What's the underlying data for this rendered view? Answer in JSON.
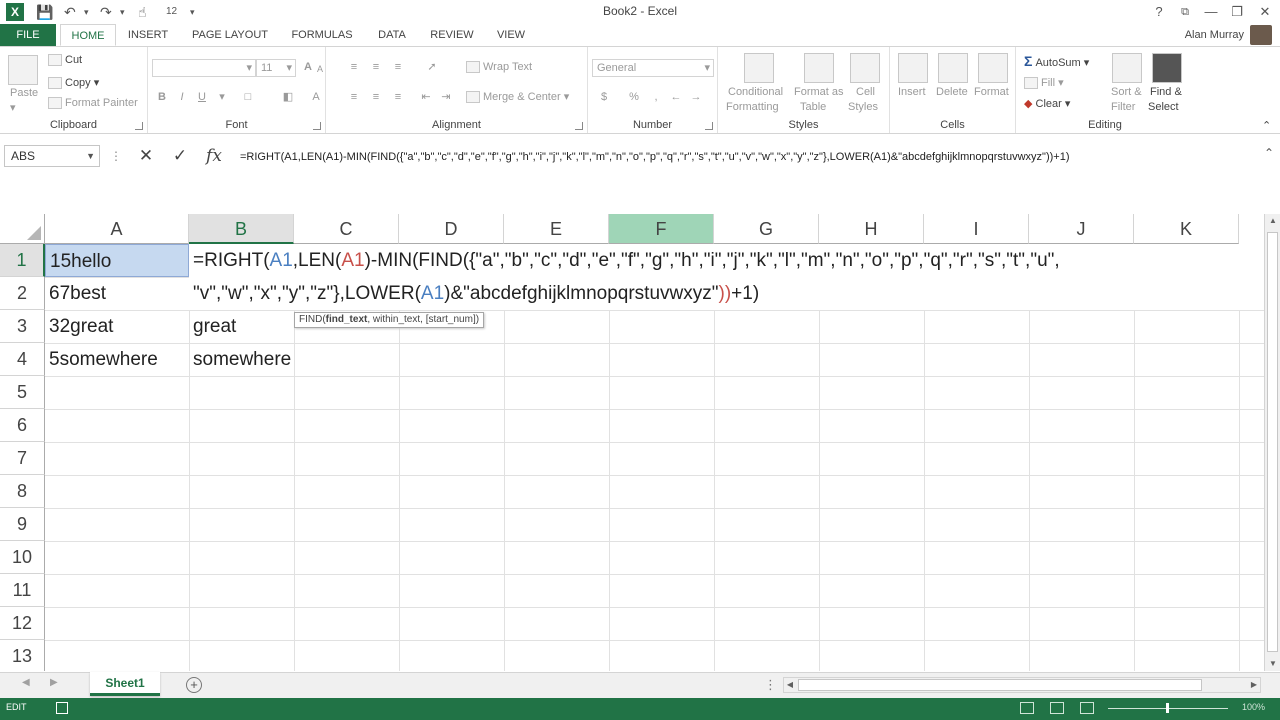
{
  "window": {
    "title": "Book2 - Excel",
    "help": "?",
    "restore": "⧉",
    "minimize": "—",
    "maximize": "❐",
    "close": "✕",
    "qat": [
      "save",
      "undo",
      "redo",
      "touch-mode"
    ]
  },
  "tabs": {
    "file": "FILE",
    "home": "HOME",
    "insert": "INSERT",
    "page_layout": "PAGE LAYOUT",
    "formulas": "FORMULAS",
    "data": "DATA",
    "review": "REVIEW",
    "view": "VIEW",
    "user": "Alan Murray"
  },
  "ribbon": {
    "clipboard": {
      "label": "Clipboard",
      "paste": "Paste",
      "cut": "Cut",
      "copy": "Copy",
      "format_painter": "Format Painter"
    },
    "font": {
      "label": "Font",
      "size": "11",
      "bold": "B",
      "italic": "I",
      "underline": "U",
      "grow": "A",
      "shrink": "A"
    },
    "alignment": {
      "label": "Alignment",
      "wrap_text": "Wrap Text",
      "merge_center": "Merge & Center"
    },
    "number": {
      "label": "Number",
      "format": "General",
      "percent": "%",
      "comma": ","
    },
    "styles": {
      "label": "Styles",
      "conditional": "Conditional",
      "formatting": "Formatting",
      "format_as": "Format as",
      "table": "Table",
      "cell": "Cell",
      "cell_styles": "Styles"
    },
    "cells": {
      "label": "Cells",
      "insert": "Insert",
      "delete": "Delete",
      "format": "Format"
    },
    "editing": {
      "label": "Editing",
      "autosum": "AutoSum",
      "fill": "Fill",
      "clear": "Clear",
      "sort": "Sort &",
      "filter": "Filter",
      "find": "Find &",
      "select": "Select"
    }
  },
  "formula_bar": {
    "name_box": "ABS",
    "cancel": "✕",
    "enter": "✓",
    "fx": "fx",
    "formula": "=RIGHT(A1,LEN(A1)-MIN(FIND({\"a\",\"b\",\"c\",\"d\",\"e\",\"f\",\"g\",\"h\",\"i\",\"j\",\"k\",\"l\",\"m\",\"n\",\"o\",\"p\",\"q\",\"r\",\"s\",\"t\",\"u\",\"v\",\"w\",\"x\",\"y\",\"z\"},LOWER(A1)&\"abcdefghijklmnopqrstuvwxyz\"))+1)"
  },
  "grid": {
    "columns": [
      "A",
      "B",
      "C",
      "D",
      "E",
      "F",
      "G",
      "H",
      "I",
      "J",
      "K"
    ],
    "rows": [
      "1",
      "2",
      "3",
      "4",
      "5",
      "6",
      "7",
      "8",
      "9",
      "10",
      "11",
      "12",
      "13"
    ],
    "col_a": [
      "15hello",
      "67best",
      "32great",
      "5somewhere"
    ],
    "col_b": [
      "",
      "",
      "great",
      "somewhere"
    ],
    "edit_line1": {
      "p1": "=RIGHT(",
      "r1": "A1",
      "p2": ",LEN(",
      "r2": "A1",
      "p3": ")-MIN(FIND(",
      "p4": "{\"a\",\"b\",\"c\",\"d\",\"e\",\"f\",\"g\",\"h\",\"i\",\"j\",\"k\",\"l\",\"m\",\"n\",\"o\",\"p\",\"q\",\"r\",\"s\",\"t\",\"u\","
    },
    "edit_line2": {
      "p1": "\"v\",\"w\",\"x\",\"y\",\"z\"},LOWER(",
      "r1": "A1",
      "p2": ")&\"abcdefghijklmnopqrstuvwxyz\"",
      "p3": "))",
      "p4": "+1)"
    },
    "tooltip": {
      "fn": "FIND(",
      "arg1": "find_text",
      "rest": ", within_text, [start_num])"
    }
  },
  "sheets": {
    "active": "Sheet1",
    "add": "+"
  },
  "status": {
    "mode": "EDIT",
    "zoom": "100%"
  }
}
